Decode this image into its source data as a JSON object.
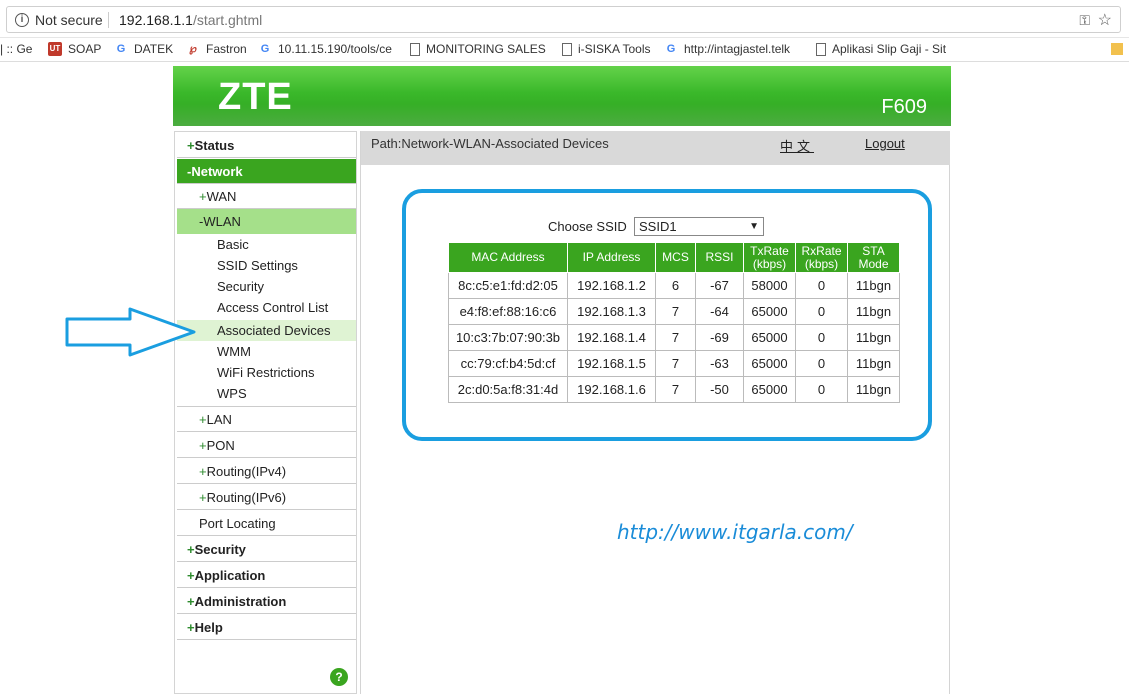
{
  "browser": {
    "security_label": "Not secure",
    "url_host": "192.168.1.1",
    "url_path": "/start.ghtml",
    "bookmarks": [
      {
        "label": "| :: Ge"
      },
      {
        "label": "SOAP"
      },
      {
        "label": "DATEK"
      },
      {
        "label": "Fastron"
      },
      {
        "label": "10.11.15.190/tools/ce"
      },
      {
        "label": "MONITORING SALES"
      },
      {
        "label": "i-SISKA Tools"
      },
      {
        "label": "http://intagjastel.telk"
      },
      {
        "label": "Aplikasi Slip Gaji - Sit"
      }
    ]
  },
  "header": {
    "logo": "ZTE",
    "model": "F609"
  },
  "path_bar": {
    "path": "Path:Network-WLAN-Associated Devices",
    "language": "中文",
    "logout": "Logout"
  },
  "sidebar": {
    "items": [
      {
        "label": "Status",
        "prefix": "+"
      },
      {
        "label": "Network",
        "prefix": "-"
      },
      {
        "label": "WAN",
        "prefix": "+"
      },
      {
        "label": "WLAN",
        "prefix": "-"
      },
      {
        "label": "Basic"
      },
      {
        "label": "SSID Settings"
      },
      {
        "label": "Security"
      },
      {
        "label": "Access Control List"
      },
      {
        "label": "Associated Devices"
      },
      {
        "label": "WMM"
      },
      {
        "label": "WiFi Restrictions"
      },
      {
        "label": "WPS"
      },
      {
        "label": "LAN",
        "prefix": "+"
      },
      {
        "label": "PON",
        "prefix": "+"
      },
      {
        "label": "Routing(IPv4)",
        "prefix": "+"
      },
      {
        "label": "Routing(IPv6)",
        "prefix": "+"
      },
      {
        "label": "Port Locating"
      },
      {
        "label": "Security",
        "prefix": "+"
      },
      {
        "label": "Application",
        "prefix": "+"
      },
      {
        "label": "Administration",
        "prefix": "+"
      },
      {
        "label": "Help",
        "prefix": "+"
      }
    ],
    "help_button": "?"
  },
  "ssid": {
    "label": "Choose SSID",
    "selected": "SSID1"
  },
  "devices_table": {
    "headers": [
      "MAC Address",
      "IP Address",
      "MCS",
      "RSSI",
      "TxRate (kbps)",
      "RxRate (kbps)",
      "STA Mode"
    ],
    "rows": [
      [
        "8c:c5:e1:fd:d2:05",
        "192.168.1.2",
        "6",
        "-67",
        "58000",
        "0",
        "11bgn"
      ],
      [
        "e4:f8:ef:88:16:c6",
        "192.168.1.3",
        "7",
        "-64",
        "65000",
        "0",
        "11bgn"
      ],
      [
        "10:c3:7b:07:90:3b",
        "192.168.1.4",
        "7",
        "-69",
        "65000",
        "0",
        "11bgn"
      ],
      [
        "cc:79:cf:b4:5d:cf",
        "192.168.1.5",
        "7",
        "-63",
        "65000",
        "0",
        "11bgn"
      ],
      [
        "2c:d0:5a:f8:31:4d",
        "192.168.1.6",
        "7",
        "-50",
        "65000",
        "0",
        "11bgn"
      ]
    ]
  },
  "watermark": "http://www.itgarla.com/",
  "colors": {
    "accent_green": "#3aa51f",
    "highlight_blue": "#1a9ee0"
  }
}
